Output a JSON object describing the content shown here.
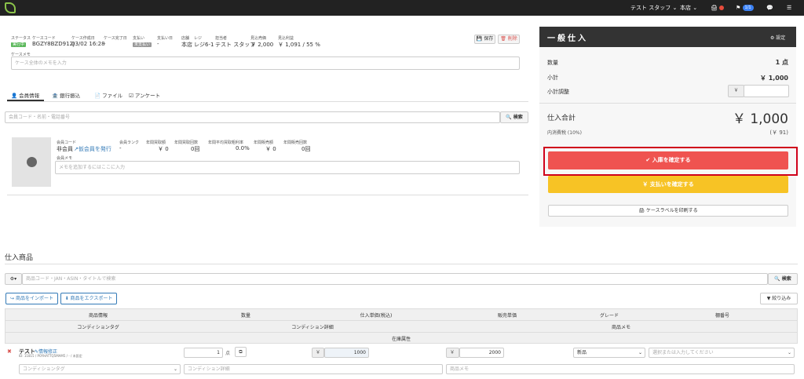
{
  "topbar": {
    "staff": "テスト スタッフ ⌄",
    "store": "本店 ⌄",
    "badge": "1/1"
  },
  "case": {
    "status_label": "ステータス",
    "status_value": "実行中",
    "code_label": "ケースコード",
    "code_value": "BGZY8BZD912J",
    "created_label": "ケース作成日",
    "created_value": "03/02 16:28",
    "done_label": "ケース完了日",
    "done_value": "-",
    "pay_label": "支払い",
    "pay_value": "未支払い",
    "paydate_label": "支払い日",
    "paydate_value": "-",
    "store_label": "店舗",
    "store_value": "本店",
    "register_label": "レジ",
    "register_value": "レジ6-1",
    "staff_label": "担当者",
    "staff_value": "テスト スタッフ",
    "price_label": "見込売価",
    "price_value": "￥ 2,000",
    "profit_label": "見込利益",
    "profit_value": "￥ 1,091 / 55 %",
    "memo_label": "ケースメモ",
    "memo_placeholder": "ケース全体のメモを入力",
    "save": "保存",
    "delete": "削除"
  },
  "tabs": [
    "会員情報",
    "銀行振込",
    "ファイル",
    "アンケート"
  ],
  "member": {
    "search_placeholder": "会員コード・名前・電話番号",
    "search_btn": "検索",
    "code_label": "会員コード",
    "code_value": "非会員",
    "issue_link": "仮会員を発行",
    "rank_label": "会員ランク",
    "rank_value": "-",
    "annual_buy_label": "年間買取額",
    "annual_buy_value": "￥ 0",
    "annual_buy_count_label": "年間買取回数",
    "annual_buy_count_value": "0回",
    "annual_rate_label": "年間平均買取粗利率",
    "annual_rate_value": "0.0%",
    "annual_sales_label": "年間販売額",
    "annual_sales_value": "￥ 0",
    "annual_sales_count_label": "年間販売回数",
    "annual_sales_count_value": "0回",
    "memo_label": "会員メモ",
    "memo_placeholder": "メモを追加するにはここに入力"
  },
  "panel": {
    "title": "一般仕入",
    "settings": "設定",
    "qty_label": "数量",
    "qty_value": "1 点",
    "subtotal_label": "小計",
    "subtotal_value": "￥ 1,000",
    "adjust_label": "小計調整",
    "adjust_prefix": "￥",
    "total_label": "仕入合計",
    "total_value": "￥ 1,000",
    "tax_label": "内消費税 (10%)",
    "tax_value": "(￥ 91)",
    "confirm_btn": "入庫を確定する",
    "pay_btn": "￥ 支払いを確定する",
    "print_btn": "ケースラベルを印刷する"
  },
  "products": {
    "title": "仕入商品",
    "search_placeholder": "商品コード・JAN・ASIN・タイトルで検索",
    "search_btn": "検索",
    "import_btn": "商品をインポート",
    "export_btn": "商品をエクスポート",
    "filter_btn": "絞り込み",
    "headers": [
      "商品情報",
      "数量",
      "仕入単価(税込)",
      "販売単価",
      "グレード",
      "棚番号"
    ],
    "subheaders": [
      "コンディションタグ",
      "コンディション詳細",
      "商品メモ"
    ],
    "stock_attr": "在庫属性",
    "row": {
      "name": "テスト",
      "edit": "情報修正",
      "id_line": "ID: 11815 / POYHATTQ5MAM5 / - / 未設定",
      "qty": "1",
      "qty_unit": "点",
      "yen": "￥",
      "cost": "1000",
      "price": "2000",
      "grade": "新品",
      "shelf_placeholder": "選択または入力してください",
      "tag_placeholder": "コンディションタグ",
      "detail_placeholder": "コンディション詳細",
      "memo_placeholder": "商品メモ"
    }
  }
}
